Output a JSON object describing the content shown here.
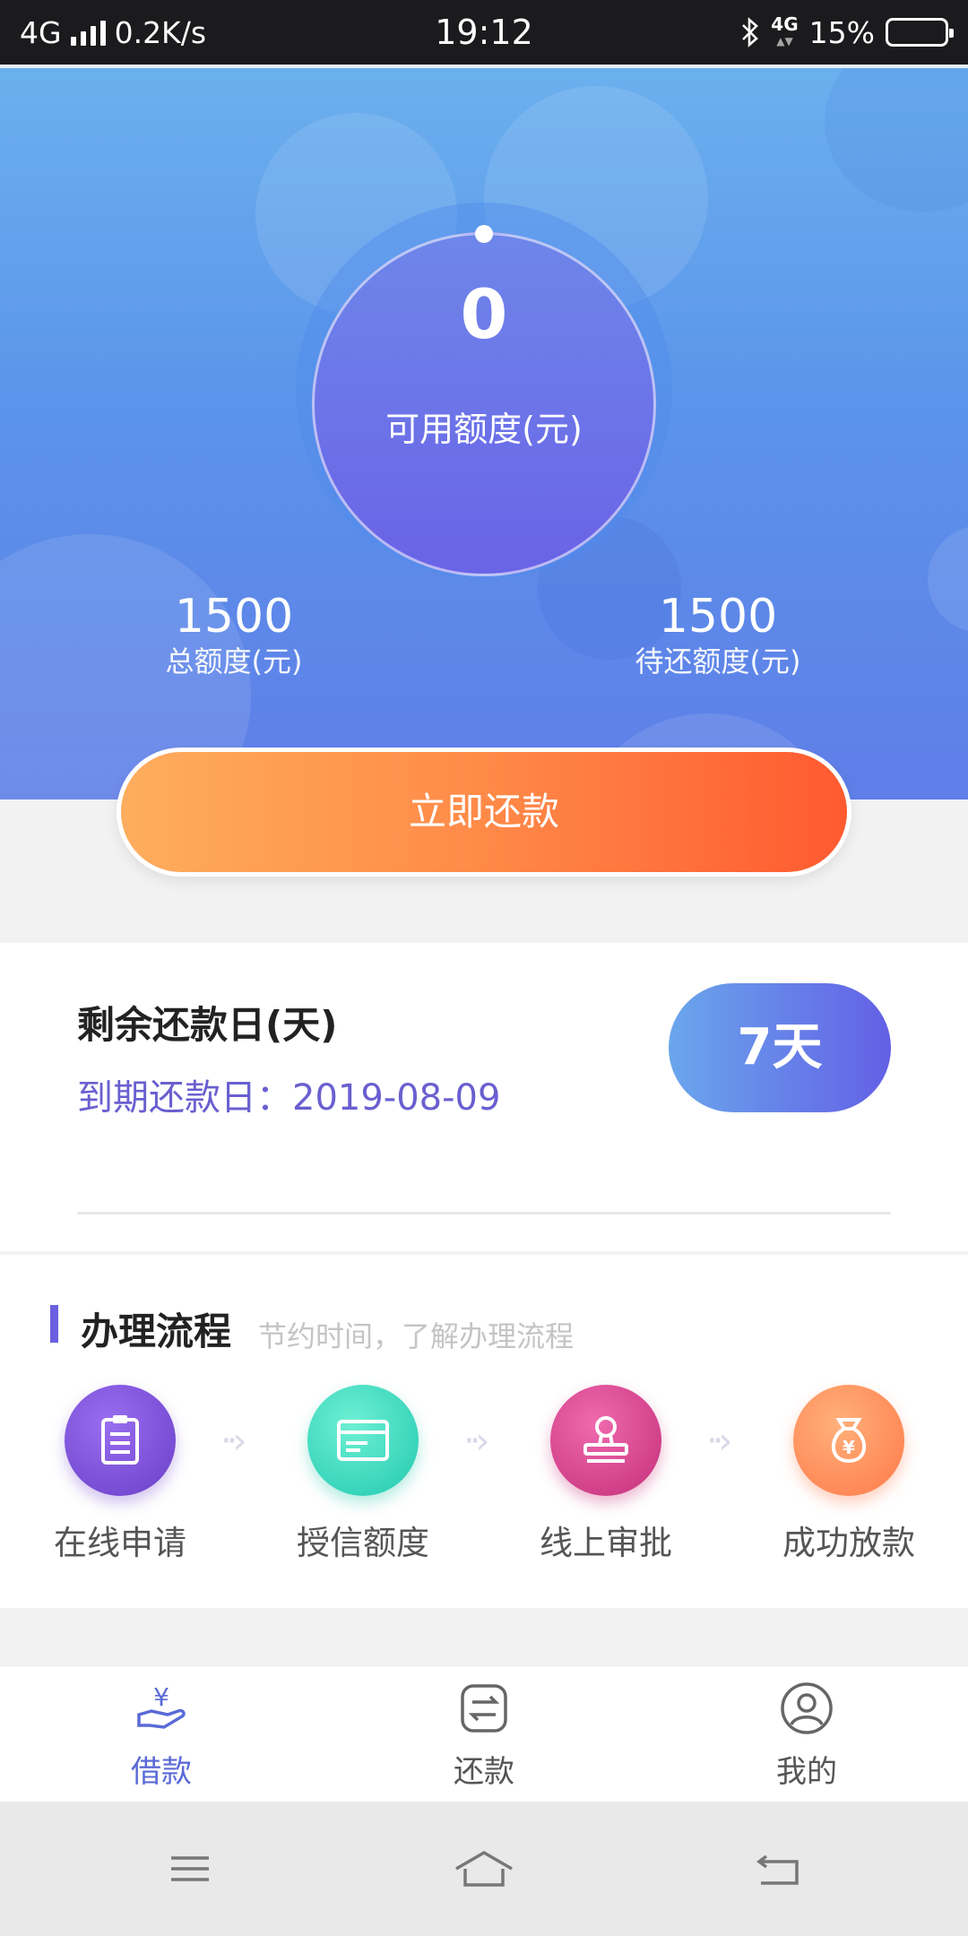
{
  "status_bar": {
    "network": "4G",
    "speed": "0.2K/s",
    "time": "19:12",
    "net_right": "4G",
    "battery": "15%",
    "battery_level": 0.15
  },
  "hero": {
    "available_amount": "0",
    "available_label": "可用额度(元)",
    "total_amount": "1500",
    "total_label": "总额度(元)",
    "pending_amount": "1500",
    "pending_label": "待还额度(元)",
    "repay_button": "立即还款"
  },
  "due": {
    "title": "剩余还款日(天)",
    "date_line": "到期还款日：2019-08-09",
    "days": "7天"
  },
  "process": {
    "title": "办理流程",
    "subtitle": "节约时间，了解办理流程",
    "steps": [
      {
        "label": "在线申请",
        "icon": "clipboard-icon",
        "color": "#7b4fd6"
      },
      {
        "label": "授信额度",
        "icon": "card-icon",
        "color": "#2fd6bf"
      },
      {
        "label": "线上审批",
        "icon": "stamp-icon",
        "color": "#d43d8c"
      },
      {
        "label": "成功放款",
        "icon": "money-bag-icon",
        "color": "#ff8a5a"
      }
    ]
  },
  "tabs": [
    {
      "label": "借款",
      "icon": "loan-icon",
      "active": true
    },
    {
      "label": "还款",
      "icon": "repay-icon",
      "active": false
    },
    {
      "label": "我的",
      "icon": "profile-icon",
      "active": false
    }
  ],
  "colors": {
    "accent": "#5a6ad6",
    "button_orange": "#ff6a38"
  }
}
